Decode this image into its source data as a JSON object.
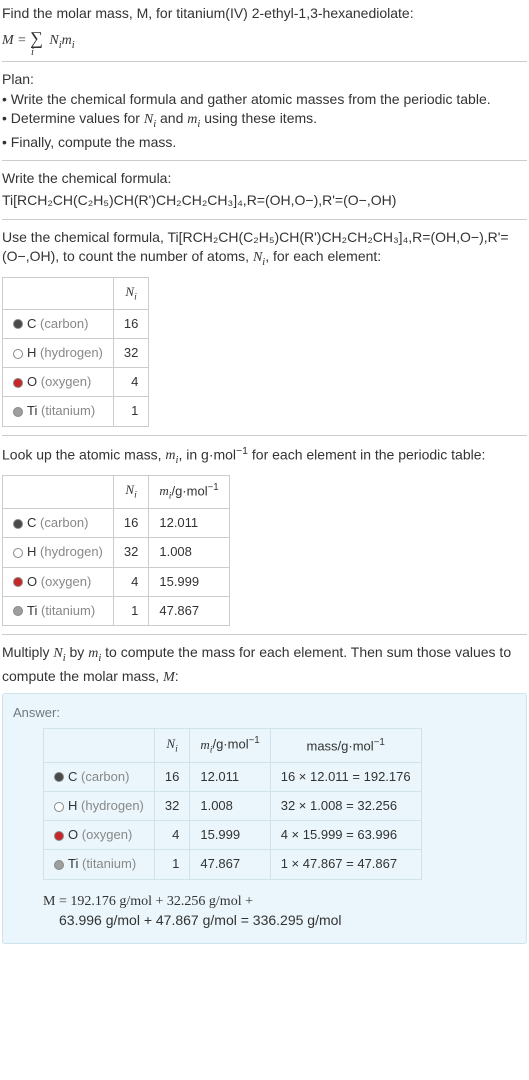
{
  "intro": {
    "line1": "Find the molar mass, M, for titanium(IV) 2-ethyl-1,3-hexanediolate:",
    "formula_html": "M = ∑ N<sub>i</sub>m<sub>i</sub>"
  },
  "plan": {
    "heading": "Plan:",
    "items": [
      "• Write the chemical formula and gather atomic masses from the periodic table.",
      "• Determine values for N_i and m_i using these items.",
      "• Finally, compute the mass."
    ]
  },
  "formula_section": {
    "heading": "Write the chemical formula:",
    "formula": "Ti[RCH₂CH(C₂H₅)CH(R')CH₂CH₂CH₃]₄,R=(OH,O−),R'=(O−,OH)"
  },
  "count_section": {
    "heading": "Use the chemical formula, Ti[RCH₂CH(C₂H₅)CH(R')CH₂CH₂CH₃]₄,R=(OH,O−),R'=(O−,OH), to count the number of atoms, N_i, for each element:",
    "header_ni": "N_i",
    "rows": [
      {
        "el": "C",
        "label": "(carbon)",
        "ni": "16",
        "swatch": "#4a4a4a"
      },
      {
        "el": "H",
        "label": "(hydrogen)",
        "ni": "32",
        "swatch": "#ffffff"
      },
      {
        "el": "O",
        "label": "(oxygen)",
        "ni": "4",
        "swatch": "#c62828"
      },
      {
        "el": "Ti",
        "label": "(titanium)",
        "ni": "1",
        "swatch": "#9e9e9e"
      }
    ]
  },
  "mass_section": {
    "heading": "Look up the atomic mass, m_i, in g·mol⁻¹ for each element in the periodic table:",
    "header_ni": "N_i",
    "header_mi": "m_i/g·mol⁻¹",
    "rows": [
      {
        "el": "C",
        "label": "(carbon)",
        "ni": "16",
        "mi": "12.011",
        "swatch": "#4a4a4a"
      },
      {
        "el": "H",
        "label": "(hydrogen)",
        "ni": "32",
        "mi": "1.008",
        "swatch": "#ffffff"
      },
      {
        "el": "O",
        "label": "(oxygen)",
        "ni": "4",
        "mi": "15.999",
        "swatch": "#c62828"
      },
      {
        "el": "Ti",
        "label": "(titanium)",
        "ni": "1",
        "mi": "47.867",
        "swatch": "#9e9e9e"
      }
    ]
  },
  "multiply_section": {
    "heading": "Multiply N_i by m_i to compute the mass for each element. Then sum those values to compute the molar mass, M:"
  },
  "answer": {
    "label": "Answer:",
    "header_ni": "N_i",
    "header_mi": "m_i/g·mol⁻¹",
    "header_mass": "mass/g·mol⁻¹",
    "rows": [
      {
        "el": "C",
        "label": "(carbon)",
        "ni": "16",
        "mi": "12.011",
        "mass": "16 × 12.011 = 192.176",
        "swatch": "#4a4a4a"
      },
      {
        "el": "H",
        "label": "(hydrogen)",
        "ni": "32",
        "mi": "1.008",
        "mass": "32 × 1.008 = 32.256",
        "swatch": "#ffffff"
      },
      {
        "el": "O",
        "label": "(oxygen)",
        "ni": "4",
        "mi": "15.999",
        "mass": "4 × 15.999 = 63.996",
        "swatch": "#c62828"
      },
      {
        "el": "Ti",
        "label": "(titanium)",
        "ni": "1",
        "mi": "47.867",
        "mass": "1 × 47.867 = 47.867",
        "swatch": "#9e9e9e"
      }
    ],
    "final1": "M = 192.176 g/mol + 32.256 g/mol +",
    "final2": "63.996 g/mol + 47.867 g/mol = 336.295 g/mol"
  }
}
